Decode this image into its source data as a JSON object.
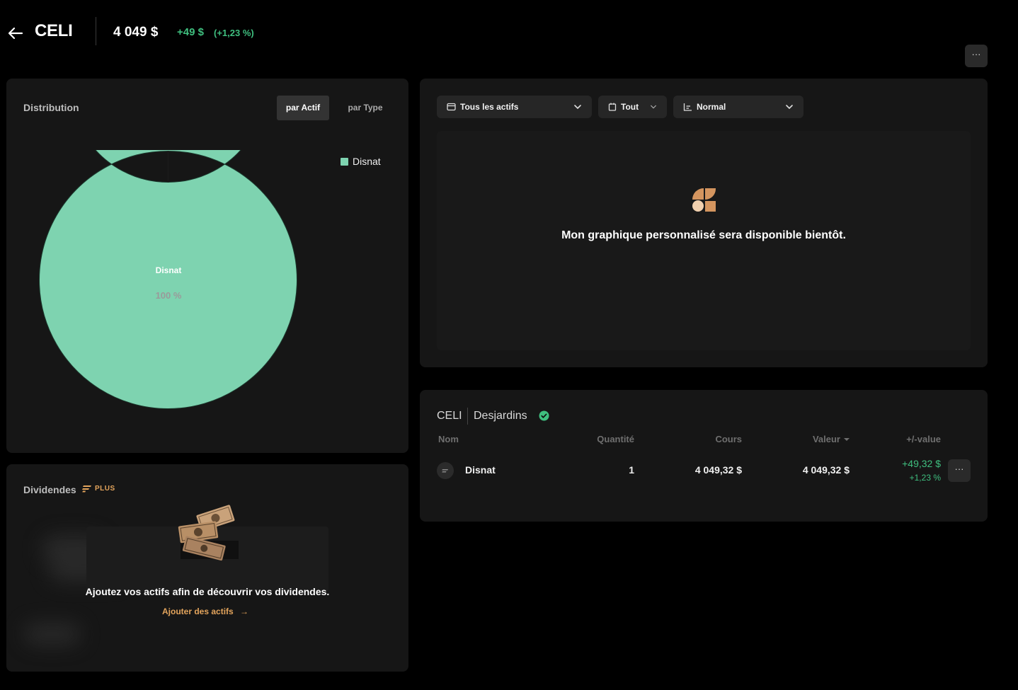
{
  "header": {
    "account": "CELI",
    "total": "4 049 $",
    "change": "+49 $",
    "change_pct": "(+1,23 %)",
    "more_label": "···"
  },
  "distribution": {
    "title": "Distribution",
    "tabs": [
      {
        "label": "par Actif",
        "active": true
      },
      {
        "label": "par Type",
        "active": false
      }
    ],
    "center_label": "Disnat",
    "center_pct": "100 %",
    "color": "#7ed3b0"
  },
  "chart_data": {
    "type": "pie",
    "categories": [
      "Disnat"
    ],
    "values": [
      100
    ],
    "legend": "top-right"
  },
  "perf_chart": {
    "filters": {
      "assets": "Tous les actifs",
      "period": "Tout",
      "mode": "Normal"
    },
    "message": "Mon graphique personnalisé sera disponible bientôt."
  },
  "dividends": {
    "title": "Dividendes",
    "badge": "PLUS",
    "message": "Ajoutez vos actifs afin de découvrir vos dividendes.",
    "link": "Ajouter des actifs",
    "accent": "#e3a45c"
  },
  "holdings": {
    "account": "CELI",
    "institution": "Desjardins",
    "columns": {
      "name": "Nom",
      "qty": "Quantité",
      "price": "Cours",
      "value": "Valeur",
      "pl": "+/-value"
    },
    "rows": [
      {
        "name": "Disnat",
        "qty": "1",
        "price": "4 049,32 $",
        "value": "4 049,32 $",
        "change": "+49,32 $",
        "change_pct": "+1,23 %"
      }
    ],
    "more_label": "···"
  },
  "colors": {
    "positive": "#3fbf7f",
    "background": "#000000",
    "card": "#161616"
  }
}
